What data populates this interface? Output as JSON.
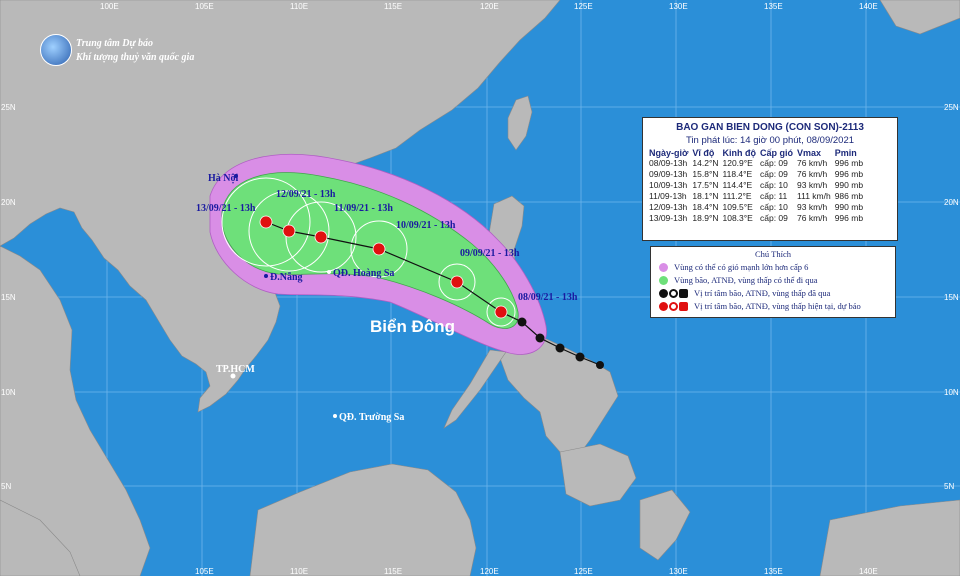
{
  "agency": {
    "line1": "Trung tâm Dự báo",
    "line2": "Khí tượng thuỷ văn quốc gia"
  },
  "axes": {
    "lon_top": [
      "100E",
      "105E",
      "110E",
      "115E",
      "120E",
      "125E",
      "130E",
      "135E",
      "140E"
    ],
    "lat_right": [
      "25N",
      "20N",
      "15N",
      "10N",
      "5N"
    ],
    "lat_left": [
      "25N",
      "20N",
      "15N",
      "10N",
      "5N"
    ],
    "lon_bottom": [
      "105E",
      "110E",
      "115E",
      "120E",
      "125E",
      "130E",
      "135E",
      "140E"
    ]
  },
  "places": {
    "hanoi": "Hà Nội",
    "danang": "Đ.Nẵng",
    "hoangsa": "QĐ. Hoàng Sa",
    "hcm": "TP.HCM",
    "truongsa": "QĐ. Trường Sa",
    "sea": "Biển Đông"
  },
  "track_labels": [
    "13/09/21 - 13h",
    "12/09/21 - 13h",
    "11/09/21 - 13h",
    "10/09/21 - 13h",
    "09/09/21 - 13h",
    "08/09/21 - 13h"
  ],
  "info": {
    "title": "BAO GAN BIEN DONG (CON SON)-2113",
    "issued": "Tin phát lúc: 14 giờ 00 phút, 08/09/2021",
    "headers": [
      "Ngày-giờ",
      "Vĩ độ",
      "Kinh độ",
      "Cấp gió",
      "Vmax",
      "Pmin"
    ],
    "rows": [
      [
        "08/09-13h",
        "14.2°N",
        "120.9°E",
        "cấp: 09",
        "76 km/h",
        "996 mb"
      ],
      [
        "09/09-13h",
        "15.8°N",
        "118.4°E",
        "cấp: 09",
        "76 km/h",
        "996 mb"
      ],
      [
        "10/09-13h",
        "17.5°N",
        "114.4°E",
        "cấp: 10",
        "93 km/h",
        "990 mb"
      ],
      [
        "11/09-13h",
        "18.1°N",
        "111.2°E",
        "cấp: 11",
        "111 km/h",
        "986 mb"
      ],
      [
        "12/09-13h",
        "18.4°N",
        "109.5°E",
        "cấp: 10",
        "93 km/h",
        "990 mb"
      ],
      [
        "13/09-13h",
        "18.9°N",
        "108.3°E",
        "cấp: 09",
        "76 km/h",
        "996 mb"
      ]
    ]
  },
  "legend": {
    "title": "Chú Thích",
    "items": [
      "Vùng có thể có gió mạnh lớn hơn cấp 6",
      "Vùng bão, ATNĐ, vùng thấp có thể đi qua",
      "Vị trí tâm bão, ATNĐ, vùng thấp đã qua",
      "Vị trí tâm bão, ATNĐ, vùng thấp hiện tại, dự báo"
    ],
    "colors": {
      "wind_zone": "#d98ee6",
      "storm_zone": "#6ee07a",
      "past": "#111111",
      "forecast": "#e01010"
    }
  }
}
